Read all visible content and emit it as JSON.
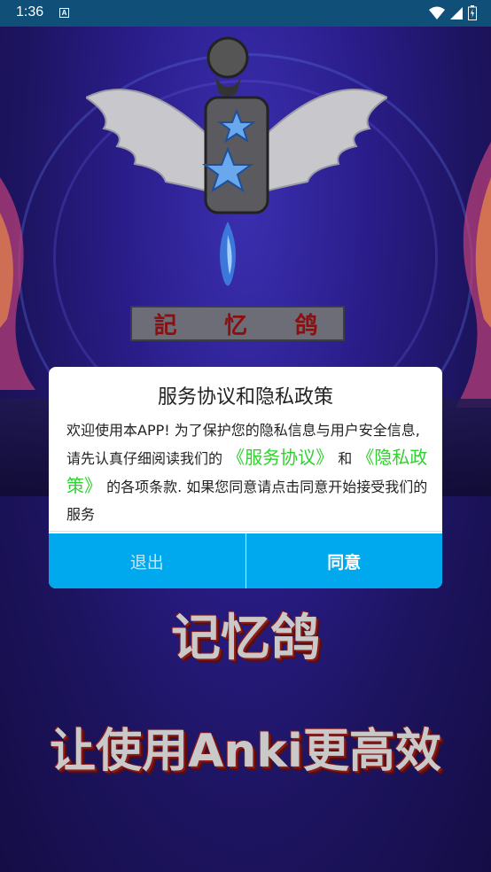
{
  "status_bar": {
    "time": "1:36",
    "notification_letter": "A"
  },
  "splash": {
    "logo_plate_chars": [
      "記",
      "忆",
      "鸽"
    ],
    "promo_title": "记忆鸽",
    "promo_subtitle": "让使用Anki更高效"
  },
  "dialog": {
    "title": "服务协议和隐私政策",
    "body_intro": "欢迎使用本APP! 为了保护您的隐私信息与用户安全信息, 请先认真仔细阅读我们的",
    "link_terms": "《服务协议》",
    "body_and": "和",
    "link_privacy": "《隐私政策》",
    "body_outro": "的各项条款. 如果您同意请点击同意开始接受我们的服务",
    "exit_label": "退出",
    "agree_label": "同意"
  },
  "colors": {
    "status_bar": "#0f4f78",
    "button_bg": "#00a8ee",
    "link": "#2fd12f",
    "background": "#1c1350"
  },
  "icons": [
    "wifi-icon",
    "cellular-signal-icon",
    "battery-icon",
    "pigeon-wings-logo-icon"
  ]
}
